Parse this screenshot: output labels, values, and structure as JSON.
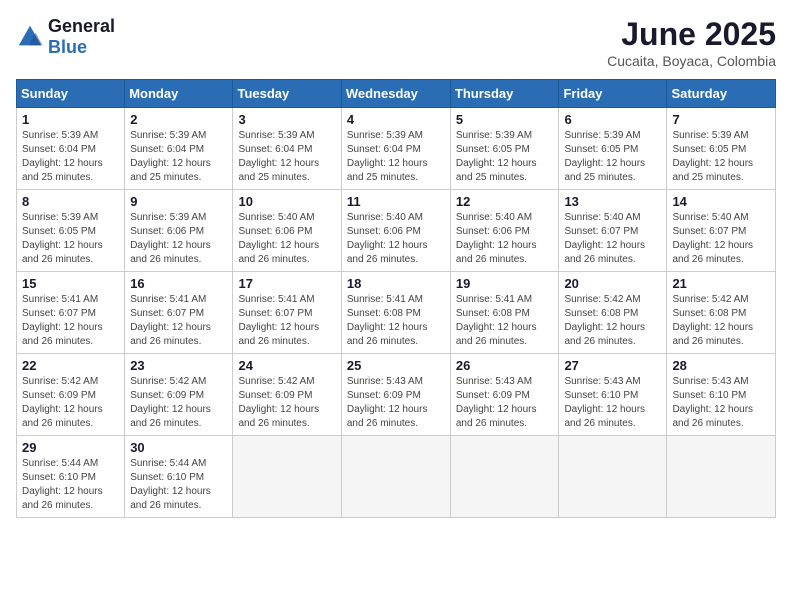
{
  "header": {
    "logo_general": "General",
    "logo_blue": "Blue",
    "month_year": "June 2025",
    "location": "Cucaita, Boyaca, Colombia"
  },
  "weekdays": [
    "Sunday",
    "Monday",
    "Tuesday",
    "Wednesday",
    "Thursday",
    "Friday",
    "Saturday"
  ],
  "weeks": [
    [
      {
        "day": "1",
        "sunrise": "5:39 AM",
        "sunset": "6:04 PM",
        "daylight": "12 hours and 25 minutes."
      },
      {
        "day": "2",
        "sunrise": "5:39 AM",
        "sunset": "6:04 PM",
        "daylight": "12 hours and 25 minutes."
      },
      {
        "day": "3",
        "sunrise": "5:39 AM",
        "sunset": "6:04 PM",
        "daylight": "12 hours and 25 minutes."
      },
      {
        "day": "4",
        "sunrise": "5:39 AM",
        "sunset": "6:04 PM",
        "daylight": "12 hours and 25 minutes."
      },
      {
        "day": "5",
        "sunrise": "5:39 AM",
        "sunset": "6:05 PM",
        "daylight": "12 hours and 25 minutes."
      },
      {
        "day": "6",
        "sunrise": "5:39 AM",
        "sunset": "6:05 PM",
        "daylight": "12 hours and 25 minutes."
      },
      {
        "day": "7",
        "sunrise": "5:39 AM",
        "sunset": "6:05 PM",
        "daylight": "12 hours and 25 minutes."
      }
    ],
    [
      {
        "day": "8",
        "sunrise": "5:39 AM",
        "sunset": "6:05 PM",
        "daylight": "12 hours and 26 minutes."
      },
      {
        "day": "9",
        "sunrise": "5:39 AM",
        "sunset": "6:06 PM",
        "daylight": "12 hours and 26 minutes."
      },
      {
        "day": "10",
        "sunrise": "5:40 AM",
        "sunset": "6:06 PM",
        "daylight": "12 hours and 26 minutes."
      },
      {
        "day": "11",
        "sunrise": "5:40 AM",
        "sunset": "6:06 PM",
        "daylight": "12 hours and 26 minutes."
      },
      {
        "day": "12",
        "sunrise": "5:40 AM",
        "sunset": "6:06 PM",
        "daylight": "12 hours and 26 minutes."
      },
      {
        "day": "13",
        "sunrise": "5:40 AM",
        "sunset": "6:07 PM",
        "daylight": "12 hours and 26 minutes."
      },
      {
        "day": "14",
        "sunrise": "5:40 AM",
        "sunset": "6:07 PM",
        "daylight": "12 hours and 26 minutes."
      }
    ],
    [
      {
        "day": "15",
        "sunrise": "5:41 AM",
        "sunset": "6:07 PM",
        "daylight": "12 hours and 26 minutes."
      },
      {
        "day": "16",
        "sunrise": "5:41 AM",
        "sunset": "6:07 PM",
        "daylight": "12 hours and 26 minutes."
      },
      {
        "day": "17",
        "sunrise": "5:41 AM",
        "sunset": "6:07 PM",
        "daylight": "12 hours and 26 minutes."
      },
      {
        "day": "18",
        "sunrise": "5:41 AM",
        "sunset": "6:08 PM",
        "daylight": "12 hours and 26 minutes."
      },
      {
        "day": "19",
        "sunrise": "5:41 AM",
        "sunset": "6:08 PM",
        "daylight": "12 hours and 26 minutes."
      },
      {
        "day": "20",
        "sunrise": "5:42 AM",
        "sunset": "6:08 PM",
        "daylight": "12 hours and 26 minutes."
      },
      {
        "day": "21",
        "sunrise": "5:42 AM",
        "sunset": "6:08 PM",
        "daylight": "12 hours and 26 minutes."
      }
    ],
    [
      {
        "day": "22",
        "sunrise": "5:42 AM",
        "sunset": "6:09 PM",
        "daylight": "12 hours and 26 minutes."
      },
      {
        "day": "23",
        "sunrise": "5:42 AM",
        "sunset": "6:09 PM",
        "daylight": "12 hours and 26 minutes."
      },
      {
        "day": "24",
        "sunrise": "5:42 AM",
        "sunset": "6:09 PM",
        "daylight": "12 hours and 26 minutes."
      },
      {
        "day": "25",
        "sunrise": "5:43 AM",
        "sunset": "6:09 PM",
        "daylight": "12 hours and 26 minutes."
      },
      {
        "day": "26",
        "sunrise": "5:43 AM",
        "sunset": "6:09 PM",
        "daylight": "12 hours and 26 minutes."
      },
      {
        "day": "27",
        "sunrise": "5:43 AM",
        "sunset": "6:10 PM",
        "daylight": "12 hours and 26 minutes."
      },
      {
        "day": "28",
        "sunrise": "5:43 AM",
        "sunset": "6:10 PM",
        "daylight": "12 hours and 26 minutes."
      }
    ],
    [
      {
        "day": "29",
        "sunrise": "5:44 AM",
        "sunset": "6:10 PM",
        "daylight": "12 hours and 26 minutes."
      },
      {
        "day": "30",
        "sunrise": "5:44 AM",
        "sunset": "6:10 PM",
        "daylight": "12 hours and 26 minutes."
      },
      null,
      null,
      null,
      null,
      null
    ]
  ]
}
